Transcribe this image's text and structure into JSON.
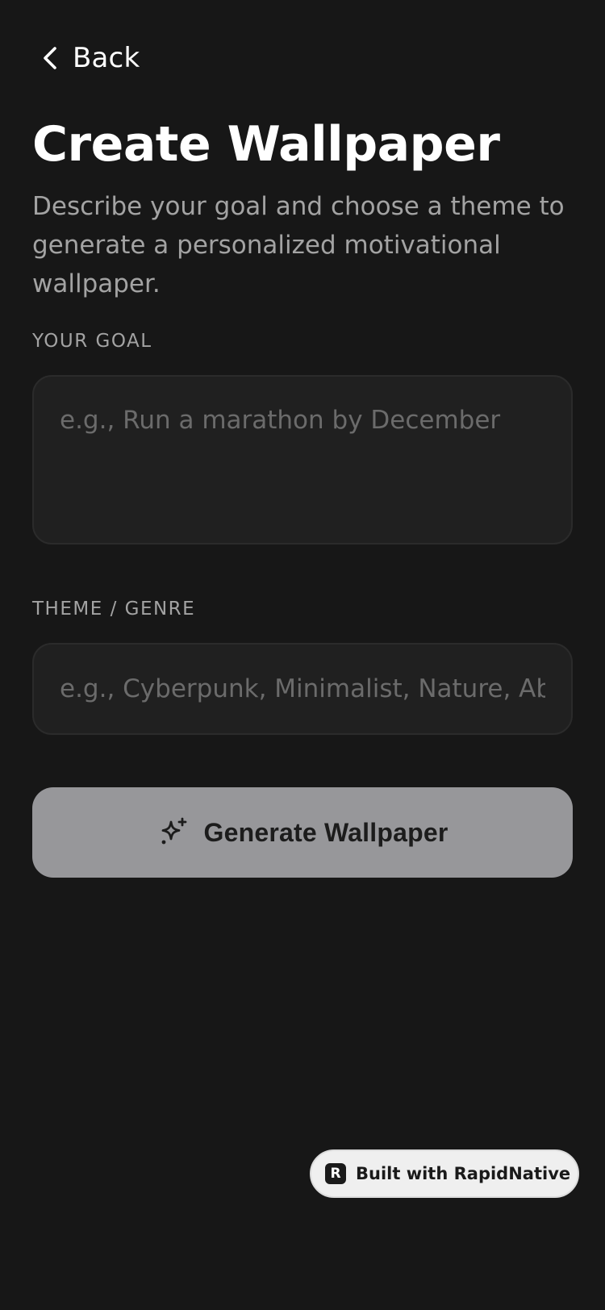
{
  "header": {
    "back_label": "Back",
    "back_icon": "chevron-left-icon"
  },
  "page": {
    "title": "Create Wallpaper",
    "description": "Describe your goal and choose a theme to generate a personalized motivational wallpaper."
  },
  "goal": {
    "label": "YOUR GOAL",
    "value": "",
    "placeholder": "e.g., Run a marathon by December"
  },
  "theme": {
    "label": "THEME / GENRE",
    "value": "",
    "placeholder": "e.g., Cyberpunk, Minimalist, Nature, Abstract"
  },
  "generate": {
    "label": "Generate Wallpaper",
    "icon": "sparkles-icon",
    "enabled": false
  },
  "badge": {
    "label": "Built with RapidNative",
    "logo_letter": "R"
  },
  "colors": {
    "background": "#171717",
    "input_background": "#202020",
    "button_disabled": "#97979a",
    "muted_text": "#a3a3a3",
    "placeholder_text": "#6b6b6b"
  }
}
